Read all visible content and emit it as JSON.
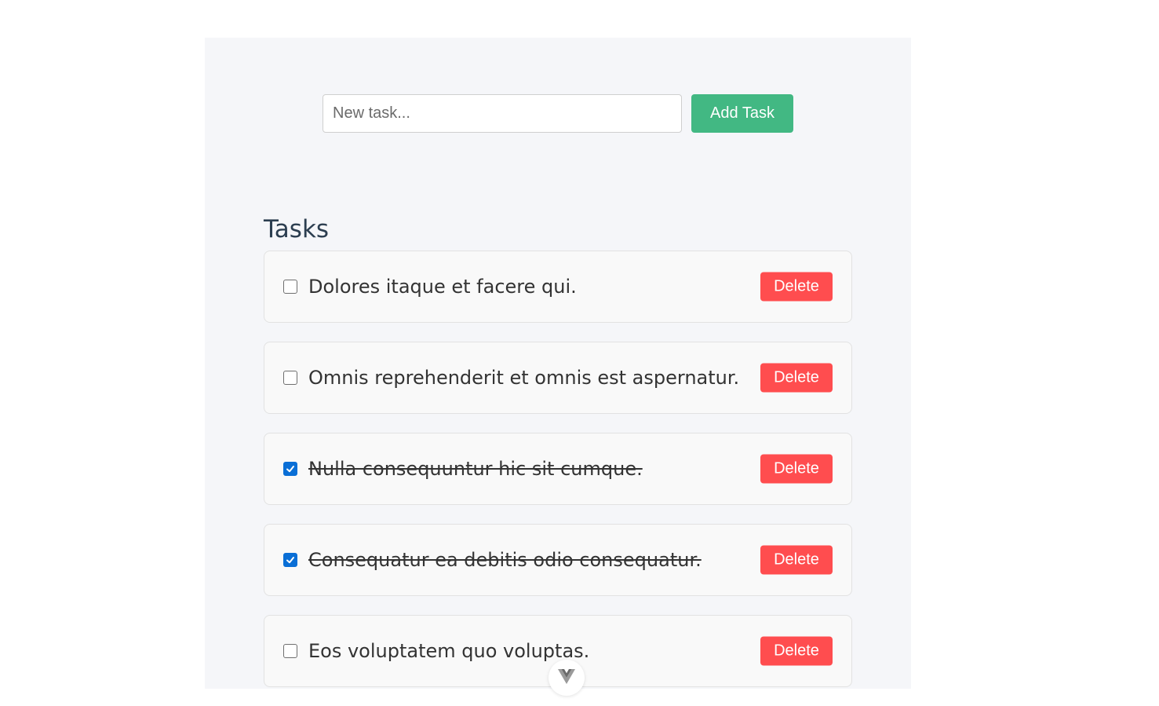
{
  "form": {
    "input_placeholder": "New task...",
    "input_value": "",
    "add_button_label": "Add Task"
  },
  "tasks_heading": "Tasks",
  "tasks": [
    {
      "text": "Dolores itaque et facere qui.",
      "completed": false,
      "delete_label": "Delete"
    },
    {
      "text": "Omnis reprehenderit et omnis est aspernatur.",
      "completed": false,
      "delete_label": "Delete"
    },
    {
      "text": "Nulla consequuntur hic sit cumque.",
      "completed": true,
      "delete_label": "Delete"
    },
    {
      "text": "Consequatur ea debitis odio consequatur.",
      "completed": true,
      "delete_label": "Delete"
    },
    {
      "text": "Eos voluptatem quo voluptas.",
      "completed": false,
      "delete_label": "Delete"
    }
  ],
  "colors": {
    "accent": "#42b883",
    "danger": "#ff4d4f",
    "checkbox_checked": "#0a6fd6",
    "panel_bg": "#f5f6f9"
  },
  "icons": {
    "devtools": "vue-logo-icon",
    "check": "check-icon"
  }
}
